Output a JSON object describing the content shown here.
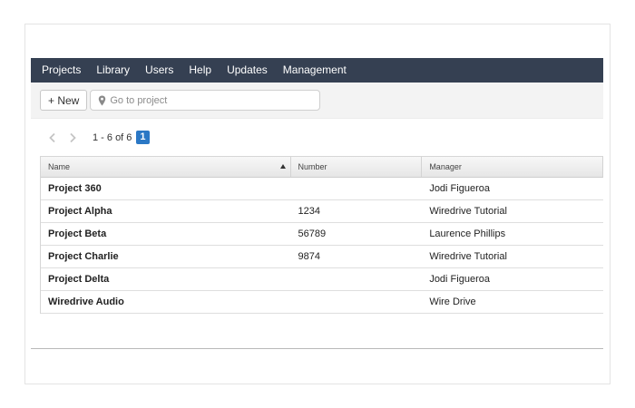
{
  "nav": {
    "items": [
      "Projects",
      "Library",
      "Users",
      "Help",
      "Updates",
      "Management"
    ]
  },
  "toolbar": {
    "new_label": "+ New",
    "search_placeholder": "Go to project",
    "search_icon": "map-pin-icon"
  },
  "pager": {
    "range": "1 - 6 of 6",
    "current_page": "1"
  },
  "table": {
    "columns": [
      "Name",
      "Number",
      "Manager"
    ],
    "sort_column": "Name",
    "sort_direction": "ascending",
    "rows": [
      {
        "name": "Project 360",
        "number": "",
        "manager": "Jodi Figueroa"
      },
      {
        "name": "Project Alpha",
        "number": "1234",
        "manager": "Wiredrive Tutorial"
      },
      {
        "name": "Project Beta",
        "number": "56789",
        "manager": "Laurence Phillips"
      },
      {
        "name": "Project Charlie",
        "number": "9874",
        "manager": "Wiredrive Tutorial"
      },
      {
        "name": "Project Delta",
        "number": "",
        "manager": "Jodi Figueroa"
      },
      {
        "name": "Wiredrive Audio",
        "number": "",
        "manager": "Wire Drive"
      }
    ]
  },
  "colors": {
    "nav_bg": "#354052",
    "accent": "#2b78c5"
  }
}
